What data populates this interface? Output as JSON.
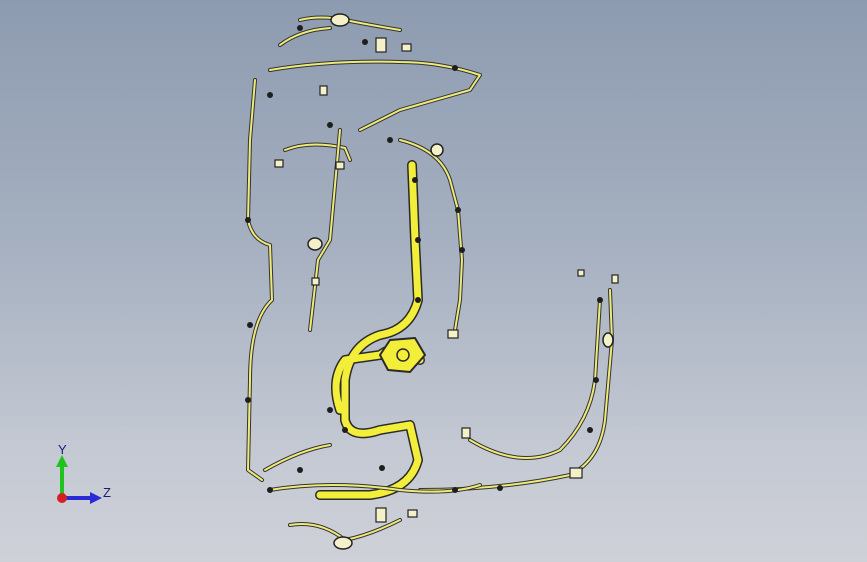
{
  "viewport": {
    "background_top": "#8d9bb0",
    "background_bottom": "#cfd1d8",
    "harness_color": "#f2ee3a",
    "harness_outline": "#2a2a2a"
  },
  "triad": {
    "y_label": "Y",
    "z_label": "Z",
    "y_color": "#1fc21f",
    "z_color": "#2a2ad6",
    "x_color": "#d62020"
  }
}
